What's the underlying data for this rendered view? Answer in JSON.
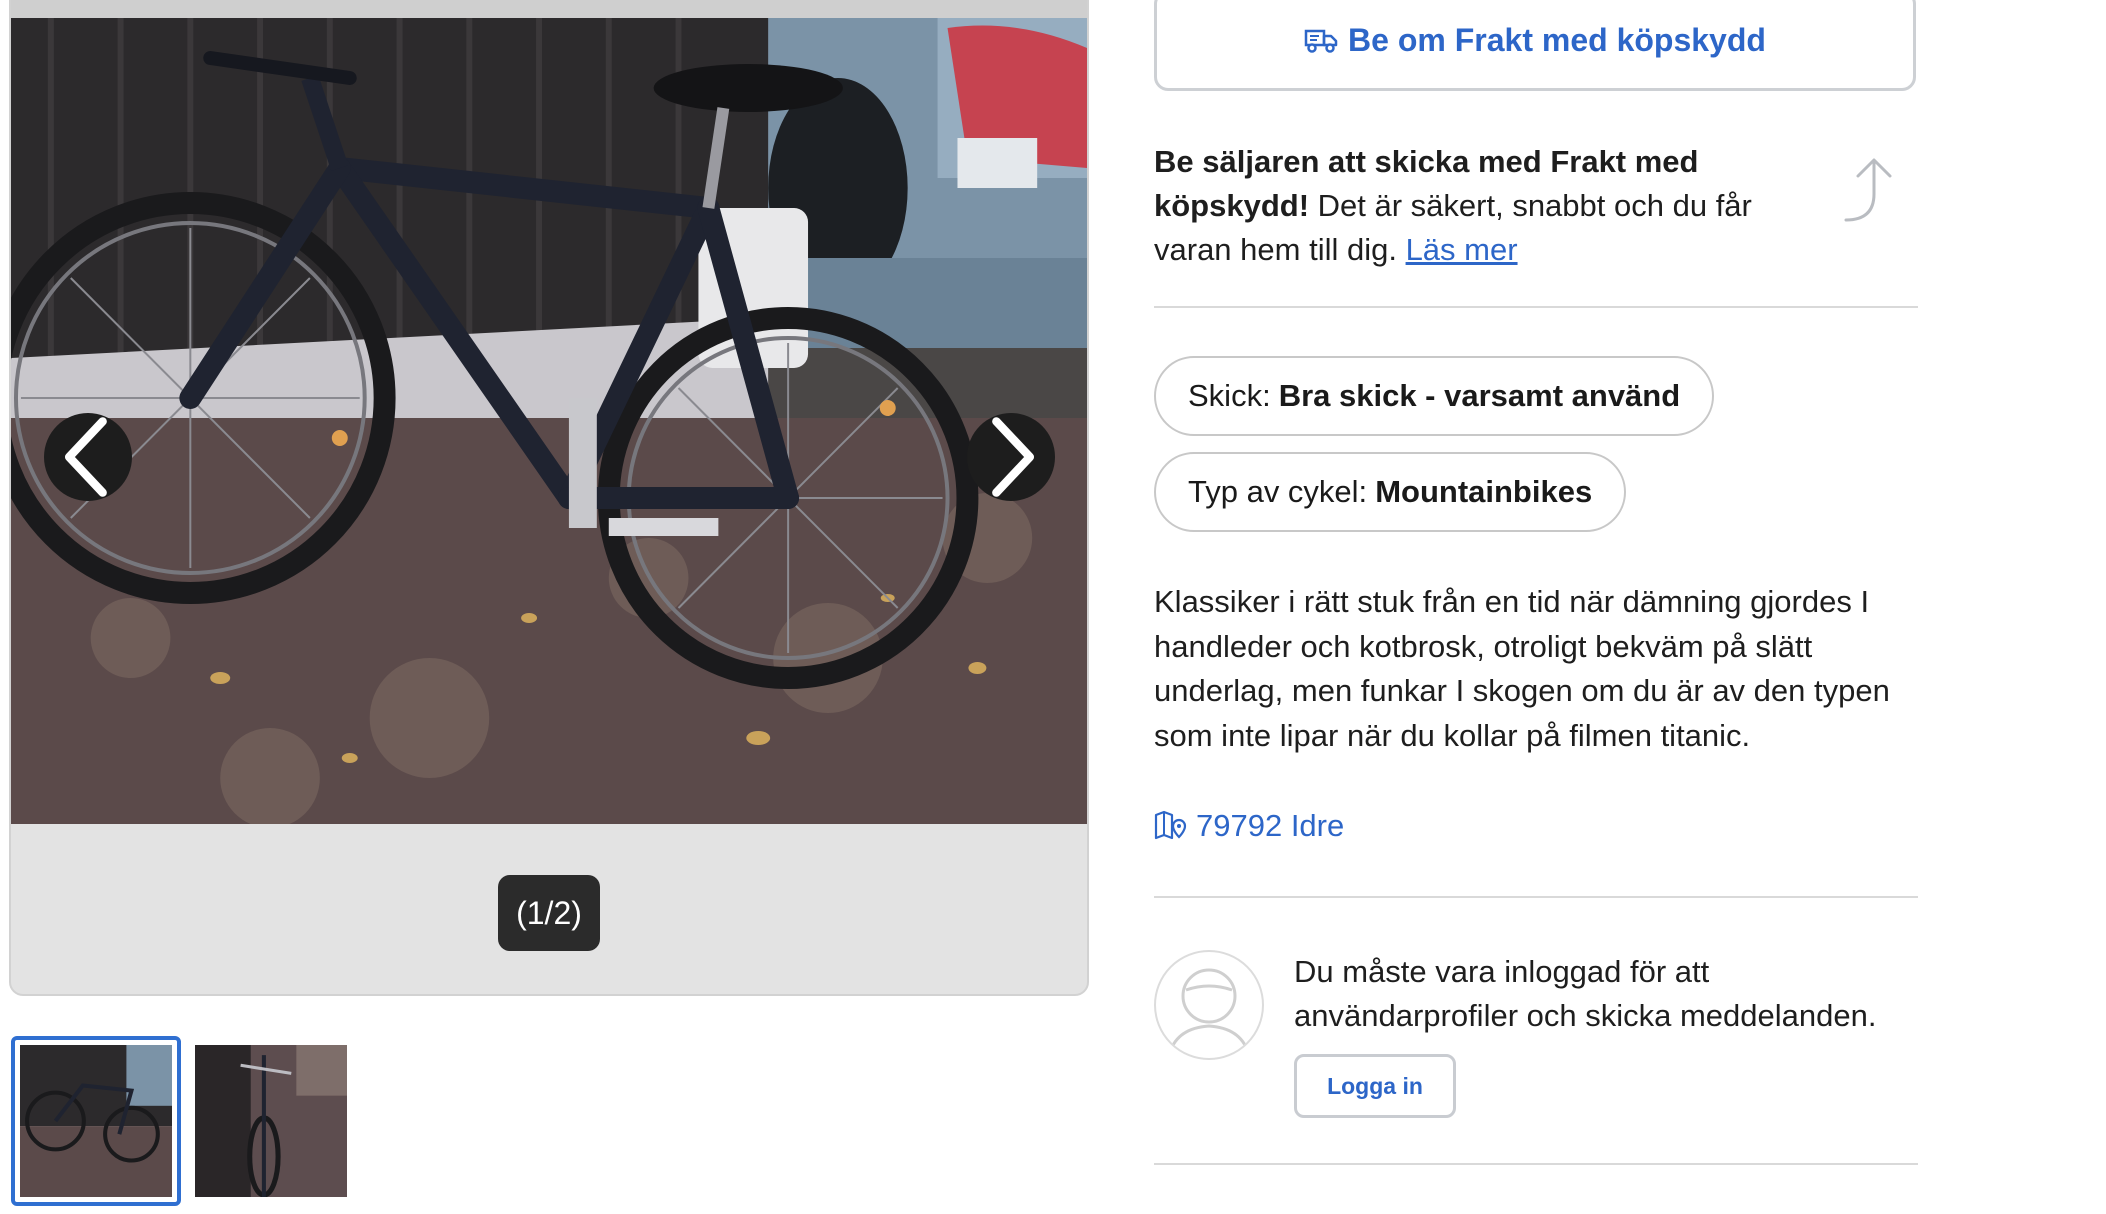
{
  "gallery": {
    "counter": "(1/2)",
    "prev_icon": "chevron-left-icon",
    "next_icon": "chevron-right-icon",
    "image_count": 2,
    "current_index": 1
  },
  "freight": {
    "button_label": "Be om Frakt med köpskydd",
    "icon": "truck-icon"
  },
  "promo": {
    "bold": "Be säljaren att skicka med Frakt med köpskydd!",
    "text": " Det är säkert, snabbt och du får varan hem till dig. ",
    "link": "Läs mer",
    "icon": "curved-arrow-up-icon"
  },
  "attributes": [
    {
      "label": "Skick:",
      "value": "Bra skick - varsamt använd"
    },
    {
      "label": "Typ av cykel:",
      "value": "Mountainbikes"
    }
  ],
  "description": "Klassiker i rätt stuk från en tid när dämning gjordes I handleder och kotbrosk, otroligt bekväm på slätt underlag, men funkar I skogen om du är av den typen som inte lipar när du kollar på filmen titanic.",
  "location": {
    "text": "79792 Idre",
    "icon": "map-pin-icon"
  },
  "login": {
    "message": "Du måste vara inloggad för att användarprofiler och skicka meddelanden.",
    "button_label": "Logga in",
    "avatar_icon": "user-avatar-icon"
  },
  "colors": {
    "accent": "#2d66c8",
    "nav_button": "#1d1d1d",
    "counter_bg": "#2b2b2b",
    "border": "#d9d9d9"
  }
}
